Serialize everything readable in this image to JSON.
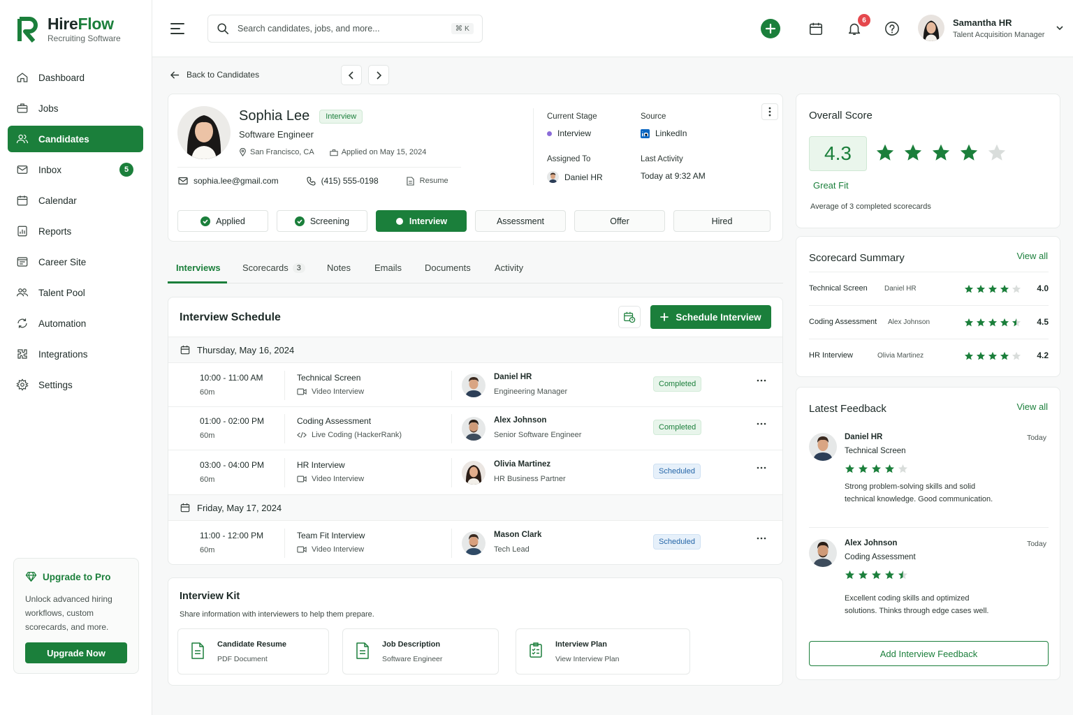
{
  "app": {
    "name": "HireFlow",
    "name_a": "Hire",
    "name_b": "Flow",
    "subtitle": "Recruiting Software"
  },
  "colors": {
    "accent": "#1b7f3b",
    "scheduled": "#2566a8",
    "badge": "#e5484d"
  },
  "sidebar": {
    "items": [
      {
        "label": "Dashboard",
        "icon": "home-icon"
      },
      {
        "label": "Jobs",
        "icon": "briefcase-icon"
      },
      {
        "label": "Candidates",
        "icon": "users-icon",
        "active": true
      },
      {
        "label": "Inbox",
        "icon": "mail-icon",
        "badge": "5"
      },
      {
        "label": "Calendar",
        "icon": "calendar-icon"
      },
      {
        "label": "Reports",
        "icon": "reports-icon"
      },
      {
        "label": "Career Site",
        "icon": "career-site-icon"
      },
      {
        "label": "Talent Pool",
        "icon": "talent-pool-icon"
      },
      {
        "label": "Automation",
        "icon": "automation-icon"
      },
      {
        "label": "Integrations",
        "icon": "integrations-icon"
      },
      {
        "label": "Settings",
        "icon": "settings-icon"
      }
    ],
    "upgrade": {
      "title": "Upgrade to Pro",
      "text": "Unlock advanced hiring workflows, custom scorecards, and more.",
      "button": "Upgrade Now"
    }
  },
  "topbar": {
    "search_placeholder": "Search candidates, jobs, and more...",
    "shortcut": "⌘ K",
    "notifications": "6",
    "user": {
      "name": "Samantha HR",
      "role": "Talent Acquisition Manager"
    }
  },
  "nav": {
    "back": "Back to Candidates"
  },
  "candidate": {
    "name": "Sophia Lee",
    "status_tag": "Interview",
    "title": "Software Engineer",
    "location": "San Francisco, CA",
    "applied": "Applied on May 15, 2024",
    "email": "sophia.lee@gmail.com",
    "phone": "(415) 555-0198",
    "resume": "Resume",
    "current_stage_label": "Current Stage",
    "current_stage": "Interview",
    "source_label": "Source",
    "source": "LinkedIn",
    "assigned_label": "Assigned To",
    "assigned": "Daniel HR",
    "last_activity_label": "Last Activity",
    "last_activity": "Today at 9:32 AM"
  },
  "pipeline": [
    {
      "label": "Applied",
      "state": "done"
    },
    {
      "label": "Screening",
      "state": "done"
    },
    {
      "label": "Interview",
      "state": "active"
    },
    {
      "label": "Assessment",
      "state": "todo"
    },
    {
      "label": "Offer",
      "state": "todo"
    },
    {
      "label": "Hired",
      "state": "todo"
    }
  ],
  "tabs": [
    {
      "label": "Interviews",
      "active": true
    },
    {
      "label": "Scorecards",
      "count": "3"
    },
    {
      "label": "Notes"
    },
    {
      "label": "Emails"
    },
    {
      "label": "Documents"
    },
    {
      "label": "Activity"
    }
  ],
  "schedule": {
    "title": "Interview Schedule",
    "button": "Schedule Interview",
    "days": [
      {
        "date": "Thursday, May 16, 2024",
        "rows": [
          {
            "time": "10:00 - 11:00 AM",
            "duration": "60m",
            "type": "Technical Screen",
            "mode": "Video Interview",
            "mode_icon": "video-icon",
            "person": "Daniel HR",
            "person_title": "Engineering Manager",
            "status": "Completed"
          },
          {
            "time": "01:00 - 02:00 PM",
            "duration": "60m",
            "type": "Coding Assessment",
            "mode": "Live Coding (HackerRank)",
            "mode_icon": "code-icon",
            "person": "Alex Johnson",
            "person_title": "Senior Software Engineer",
            "status": "Completed"
          },
          {
            "time": "03:00 - 04:00 PM",
            "duration": "60m",
            "type": "HR Interview",
            "mode": "Video Interview",
            "mode_icon": "video-icon",
            "person": "Olivia Martinez",
            "person_title": "HR Business Partner",
            "status": "Scheduled"
          }
        ]
      },
      {
        "date": "Friday, May 17, 2024",
        "rows": [
          {
            "time": "11:00 - 12:00 PM",
            "duration": "60m",
            "type": "Team Fit Interview",
            "mode": "Video Interview",
            "mode_icon": "video-icon",
            "person": "Mason Clark",
            "person_title": "Tech Lead",
            "status": "Scheduled"
          }
        ]
      }
    ]
  },
  "kit": {
    "title": "Interview Kit",
    "subtitle": "Share information with interviewers to help them prepare.",
    "items": [
      {
        "title": "Candidate Resume",
        "subtitle": "PDF Document"
      },
      {
        "title": "Job Description",
        "subtitle": "Software Engineer"
      },
      {
        "title": "Interview Plan",
        "subtitle": "View Interview Plan"
      }
    ]
  },
  "overall": {
    "title": "Overall Score",
    "score": "4.3",
    "stars": 4,
    "label": "Great Fit",
    "note": "Average of 3 completed scorecards"
  },
  "scorecard": {
    "title": "Scorecard Summary",
    "view_all": "View all",
    "rows": [
      {
        "name": "Technical Screen",
        "by": "Daniel HR",
        "value": "4.0",
        "stars": 4
      },
      {
        "name": "Coding Assessment",
        "by": "Alex Johnson",
        "value": "4.5",
        "stars": 4.5
      },
      {
        "name": "HR Interview",
        "by": "Olivia Martinez",
        "value": "4.2",
        "stars": 4
      }
    ]
  },
  "feedback": {
    "title": "Latest Feedback",
    "view_all": "View all",
    "items": [
      {
        "name": "Daniel HR",
        "time": "Today",
        "type": "Technical Screen",
        "stars": 4,
        "text": "Strong problem-solving skills and solid technical knowledge. Good communication."
      },
      {
        "name": "Alex Johnson",
        "time": "Today",
        "type": "Coding Assessment",
        "stars": 4.5,
        "text": "Excellent coding skills and optimized solutions. Thinks through edge cases well."
      }
    ],
    "button": "Add Interview Feedback"
  }
}
